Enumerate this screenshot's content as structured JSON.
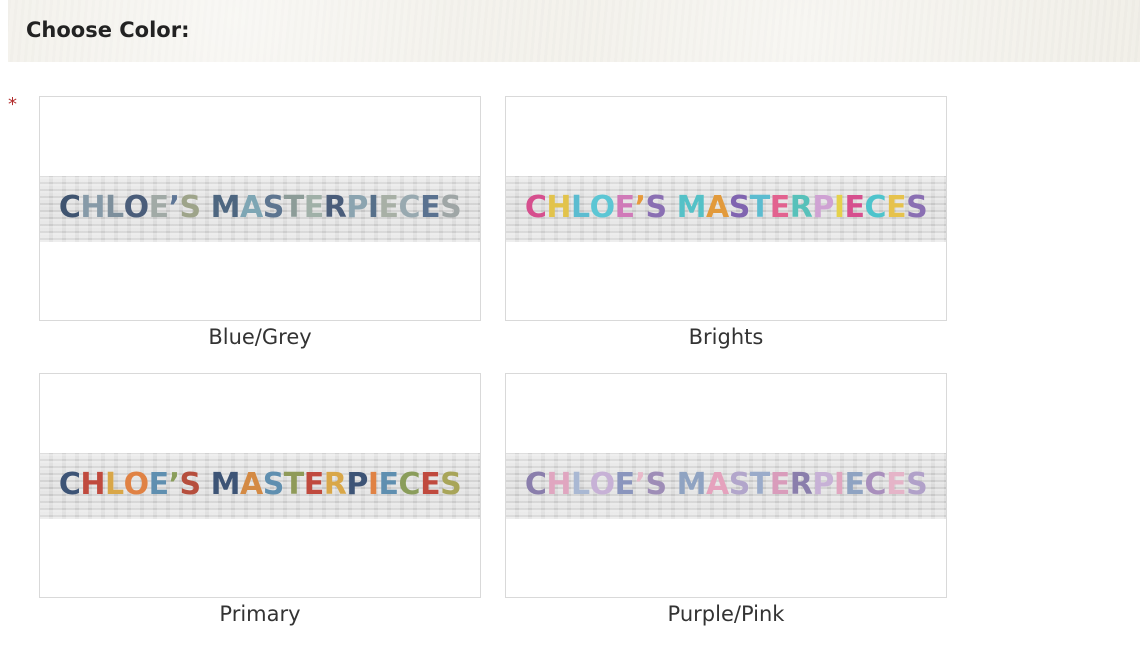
{
  "header": {
    "title": "Choose Color:"
  },
  "required_mark": "*",
  "options": [
    {
      "label": "Blue/Grey",
      "banner_text": "CHLOE'S MASTERPIECES",
      "letter_colors": [
        "#3f5470",
        "#869aa8",
        "#7d8f9c",
        "#4a5d7a",
        "#a1aaa6",
        "#5e7696",
        "#9ea48a",
        "#4d6680",
        "#7ea6b4",
        "#5d7590",
        "#8c9c98",
        "#a0b0a8",
        "#4a5d7a",
        "#8ba4b0",
        "#56708a",
        "#a8b0a6",
        "#98a9b0",
        "#5a7290",
        "#9fa6a6"
      ]
    },
    {
      "label": "Brights",
      "banner_text": "CHLOE'S MASTERPIECES",
      "letter_colors": [
        "#d64f8e",
        "#e2c34c",
        "#5bbcd0",
        "#5cc6d4",
        "#d07ab8",
        "#e79a3a",
        "#8a6fb3",
        "#55c1c7",
        "#e29a3b",
        "#8064b0",
        "#5bbcd0",
        "#e2628f",
        "#57c1ba",
        "#cfa2d3",
        "#e5d24a",
        "#d64f8e",
        "#4ec4cc",
        "#e6c24c",
        "#8a6fb3"
      ]
    },
    {
      "label": "Primary",
      "banner_text": "CHLOE'S MASTERPIECES",
      "letter_colors": [
        "#3d5476",
        "#c04a3e",
        "#d9a748",
        "#e08244",
        "#5f8fb0",
        "#8a9d5b",
        "#b64e3d",
        "#3d5476",
        "#d48a44",
        "#5f8fb0",
        "#8f9a58",
        "#c04a3e",
        "#d9a748",
        "#3d5476",
        "#e08244",
        "#5f8fb0",
        "#8a9d5b",
        "#c04a3e",
        "#a8a559"
      ]
    },
    {
      "label": "Purple/Pink",
      "banner_text": "CHLOE'S MASTERPIECES",
      "letter_colors": [
        "#8a7eac",
        "#e0a6c0",
        "#a9b8d3",
        "#c7b1d6",
        "#8a95bd",
        "#e9b9ca",
        "#9e8db7",
        "#8fa3c2",
        "#e5a2bd",
        "#b2a6cb",
        "#9aabca",
        "#d99cbb",
        "#8a7eac",
        "#c7b1d6",
        "#e0a6c0",
        "#8fa3c2",
        "#a98fbd",
        "#e5b4c8",
        "#b1a1c9"
      ]
    }
  ]
}
